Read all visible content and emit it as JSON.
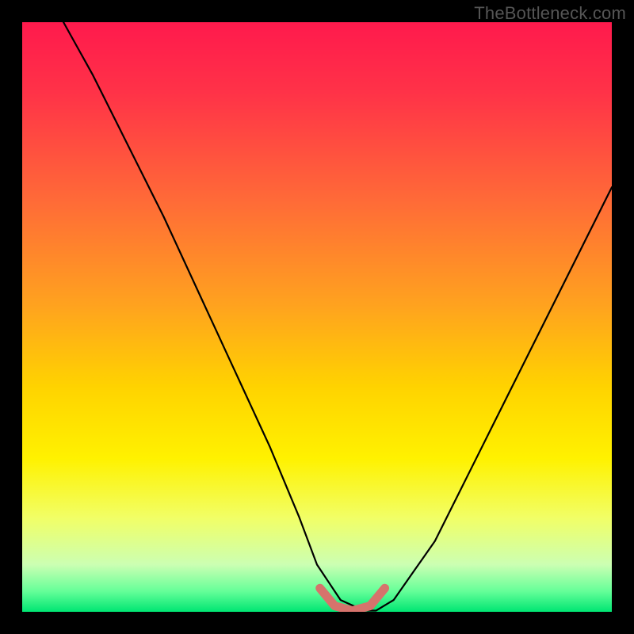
{
  "watermark": "TheBottleneck.com",
  "chart_data": {
    "type": "line",
    "title": "",
    "xlabel": "",
    "ylabel": "",
    "xlim": [
      0,
      100
    ],
    "ylim": [
      0,
      100
    ],
    "grid": false,
    "legend": false,
    "series": [
      {
        "name": "curve",
        "interpretation": "vertical gradient background red->yellow->green; V-shaped black curve with minimum plateau; salmon highlight at valley segment",
        "x": [
          7,
          12,
          18,
          24,
          30,
          36,
          42,
          47,
          50,
          54,
          58,
          60,
          63,
          70,
          78,
          86,
          94,
          100
        ],
        "y": [
          100,
          91,
          79,
          67,
          54,
          41,
          28,
          16,
          8,
          2,
          0.2,
          0.2,
          2,
          12,
          28,
          44,
          60,
          72
        ]
      }
    ],
    "highlight": {
      "x": [
        50.5,
        53,
        56,
        59,
        61.5
      ],
      "y": [
        4,
        1,
        0.2,
        1,
        4
      ],
      "color": "#d6736c"
    },
    "gradient_stops": [
      {
        "pos": 0.0,
        "color": "#ff1a4d"
      },
      {
        "pos": 0.12,
        "color": "#ff3348"
      },
      {
        "pos": 0.3,
        "color": "#ff6a38"
      },
      {
        "pos": 0.48,
        "color": "#ffa31f"
      },
      {
        "pos": 0.62,
        "color": "#ffd400"
      },
      {
        "pos": 0.74,
        "color": "#fff200"
      },
      {
        "pos": 0.84,
        "color": "#f2ff66"
      },
      {
        "pos": 0.92,
        "color": "#ccffb3"
      },
      {
        "pos": 0.965,
        "color": "#66ff99"
      },
      {
        "pos": 1.0,
        "color": "#00e673"
      }
    ]
  }
}
